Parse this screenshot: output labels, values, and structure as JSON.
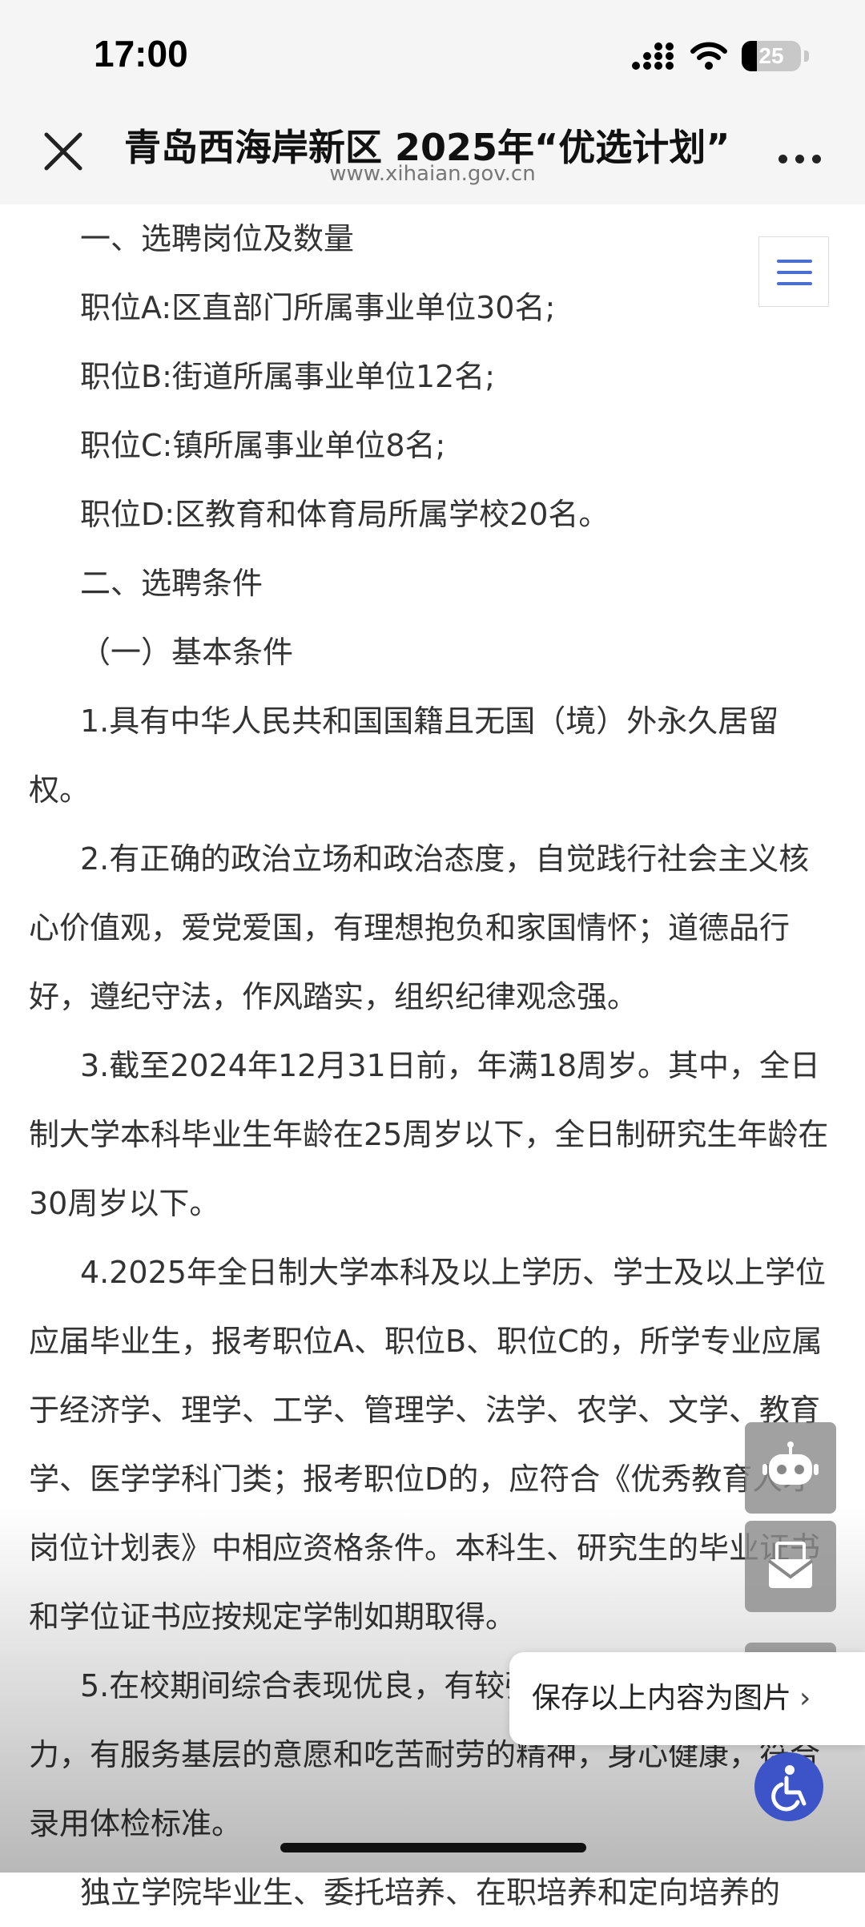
{
  "status_bar": {
    "time": "17:00",
    "battery_text": "25",
    "battery_level": 0.25,
    "icons": [
      "signal-icon",
      "wifi-icon",
      "battery-icon"
    ]
  },
  "nav": {
    "title": "青岛西海岸新区 2025年“优选计划”",
    "subtitle": "www.xihaian.gov.cn"
  },
  "article": {
    "paragraphs": [
      "一、选聘岗位及数量",
      "职位A:区直部门所属事业单位30名;",
      "职位B:街道所属事业单位12名;",
      "职位C:镇所属事业单位8名;",
      "职位D:区教育和体育局所属学校20名。",
      "二、选聘条件",
      "（一）基本条件",
      "1.具有中华人民共和国国籍且无国（境）外永久居留权。",
      "2.有正确的政治立场和政治态度，自觉践行社会主义核心价值观，爱党爱国，有理想抱负和家国情怀；道德品行好，遵纪守法，作风踏实，组织纪律观念强。",
      "3.截至2024年12月31日前，年满18周岁。其中，全日制大学本科毕业生年龄在25周岁以下，全日制研究生年龄在30周岁以下。",
      "4.2025年全日制大学本科及以上学历、学士及以上学位应届毕业生，报考职位A、职位B、职位C的，所学专业应属于经济学、理学、工学、管理学、法学、农学、文学、教育学、医学学科门类；报考职位D的，应符合《优秀教育人才岗位计划表》中相应资格条件。本科生、研究生的毕业证书和学位证书应按规定学制如期取得。",
      "5.在校期间综合表现优良，有较强的语言文字表达能力，有服务基层的意愿和吃苦耐劳的精神，身心健康，符合录用体检标准。",
      "独立学院毕业生、委托培养、在职培养和定向培养的"
    ]
  },
  "popup": {
    "save_label": "保存以上内容为图片",
    "chevron": "›"
  },
  "floating": {
    "icons": [
      "toc-list-icon",
      "robot-icon",
      "mail-icon",
      "accessibility-icon"
    ]
  },
  "colors": {
    "accent": "#4a6fd1",
    "accessibility": "#3c54c8"
  }
}
